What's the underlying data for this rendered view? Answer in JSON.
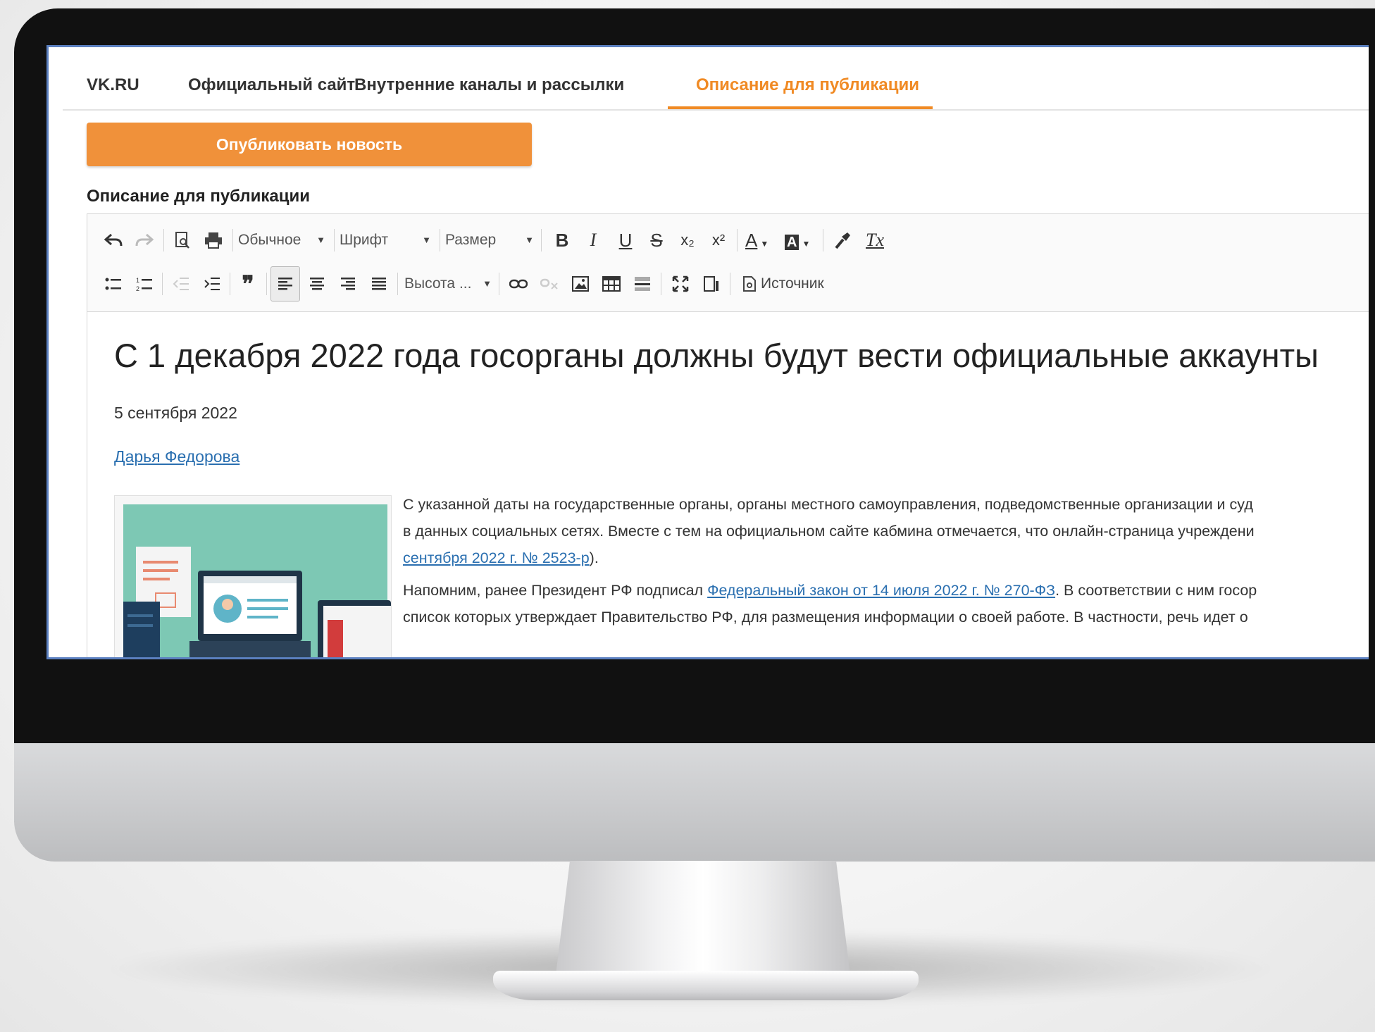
{
  "tabs": [
    {
      "label": "VK.RU",
      "active": false
    },
    {
      "label": "Официальный сайт",
      "active": false
    },
    {
      "label": "Внутренние каналы и рассылки",
      "active": false
    },
    {
      "label": "Описание для публикации",
      "active": true
    }
  ],
  "publish_button": {
    "label": "Опубликовать новость"
  },
  "section_label": "Описание для публикации",
  "toolbar": {
    "format_combo": "Обычное",
    "font_combo": "Шрифт",
    "size_combo": "Размер",
    "line_height_combo": "Высота ...",
    "source_label": "Источник",
    "bold": "B",
    "italic": "I",
    "underline": "U",
    "strike": "S",
    "subscript": "x₂",
    "superscript": "x²",
    "text_color": "A",
    "bg_color": "A",
    "clear_format": "Tx"
  },
  "article": {
    "headline": "С 1 декабря 2022 года госорганы должны будут вести официальные аккаунты",
    "date": "5 сентября 2022",
    "author": "Дарья Федорова",
    "p1_line1": "С указанной даты на государственные органы, органы местного самоуправления, подведомственные организации и суд",
    "p1_line2": "в данных социальных сетях. Вместе с тем на официальном сайте кабмина отмечается, что онлайн-страница учреждени",
    "p1_link": "сентября 2022 г. № 2523-р",
    "p1_tail": ").",
    "p2_start": "Напомним, ранее Президент РФ подписал ",
    "p2_link": "Федеральный закон от 14 июля 2022 г. № 270-ФЗ",
    "p2_end": ". В соответствии с ним госор",
    "p2_line2": "список которых утверждает Правительство РФ, для размещения информации о своей работе. В частности, речь идет о"
  },
  "colors": {
    "accent": "#f08a24",
    "button": "#f0913a",
    "link": "#2a6fb0",
    "screen_border": "#5b80c0"
  }
}
